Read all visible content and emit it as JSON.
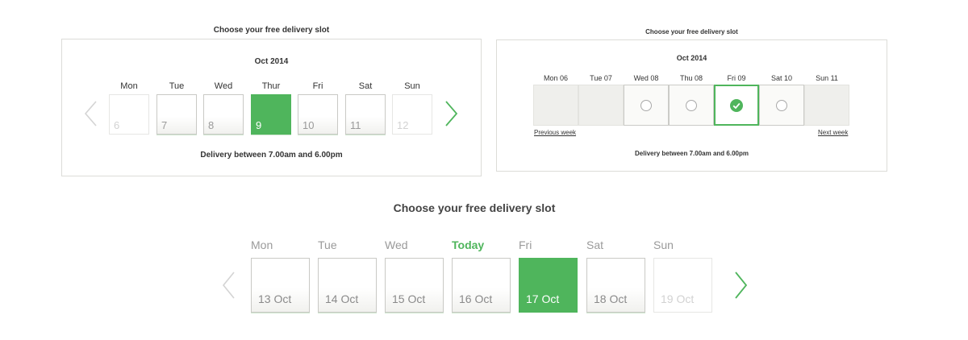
{
  "colors": {
    "accent": "#4fb55c",
    "border": "#dcdcd8",
    "text": "#333333"
  },
  "widget_a": {
    "title": "Choose your free delivery slot",
    "month": "Oct 2014",
    "days": [
      {
        "name": "Mon",
        "date": "6",
        "state": "disabled"
      },
      {
        "name": "Tue",
        "date": "7",
        "state": "available"
      },
      {
        "name": "Wed",
        "date": "8",
        "state": "available"
      },
      {
        "name": "Thur",
        "date": "9",
        "state": "selected"
      },
      {
        "name": "Fri",
        "date": "10",
        "state": "available"
      },
      {
        "name": "Sat",
        "date": "11",
        "state": "available"
      },
      {
        "name": "Sun",
        "date": "12",
        "state": "disabled"
      }
    ],
    "prev_icon": "chevron-left-icon",
    "next_icon": "chevron-right-icon",
    "delivery_note": "Delivery between 7.00am and 6.00pm"
  },
  "widget_b": {
    "title": "Choose your free delivery slot",
    "month": "Oct 2014",
    "days": [
      {
        "name": "Mon 06",
        "state": "unavailable"
      },
      {
        "name": "Tue 07",
        "state": "unavailable"
      },
      {
        "name": "Wed 08",
        "state": "available"
      },
      {
        "name": "Thu 08",
        "state": "available"
      },
      {
        "name": "Fri 09",
        "state": "selected"
      },
      {
        "name": "Sat 10",
        "state": "available"
      },
      {
        "name": "Sun 11",
        "state": "unavailable"
      }
    ],
    "prev_link": "Previous week",
    "next_link": "Next week",
    "delivery_note": "Delivery between 7.00am and 6.00pm"
  },
  "widget_c": {
    "title": "Choose your free delivery slot",
    "days": [
      {
        "name": "Mon",
        "date": "13 Oct",
        "state": "available"
      },
      {
        "name": "Tue",
        "date": "14 Oct",
        "state": "available"
      },
      {
        "name": "Wed",
        "date": "15 Oct",
        "state": "available"
      },
      {
        "name": "Today",
        "date": "16 Oct",
        "state": "available",
        "today": true
      },
      {
        "name": "Fri",
        "date": "17 Oct",
        "state": "selected"
      },
      {
        "name": "Sat",
        "date": "18 Oct",
        "state": "available"
      },
      {
        "name": "Sun",
        "date": "19 Oct",
        "state": "disabled"
      }
    ],
    "prev_icon": "chevron-left-icon",
    "next_icon": "chevron-right-icon"
  }
}
